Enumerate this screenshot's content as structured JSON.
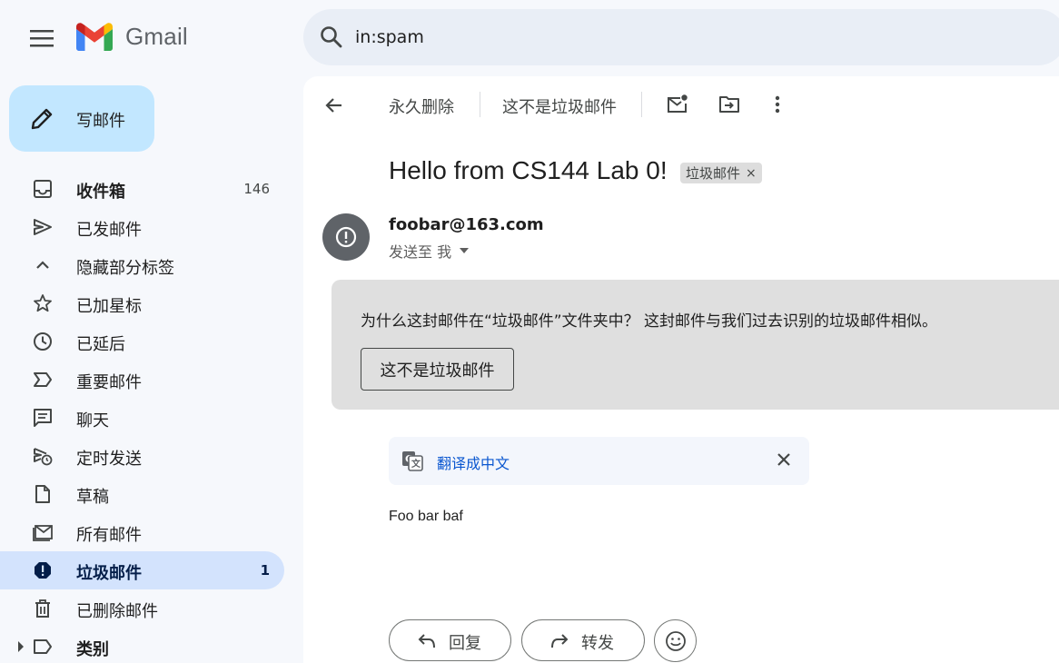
{
  "app": {
    "name": "Gmail"
  },
  "search": {
    "value": "in:spam"
  },
  "compose": {
    "label": "写邮件"
  },
  "sidebar": {
    "items": [
      {
        "label": "收件箱",
        "count": "146",
        "icon": "inbox-icon"
      },
      {
        "label": "已发邮件",
        "icon": "send-icon"
      },
      {
        "label": "隐藏部分标签",
        "icon": "chevron-up-icon"
      },
      {
        "label": "已加星标",
        "icon": "star-icon"
      },
      {
        "label": "已延后",
        "icon": "clock-icon"
      },
      {
        "label": "重要邮件",
        "icon": "important-icon"
      },
      {
        "label": "聊天",
        "icon": "chat-icon"
      },
      {
        "label": "定时发送",
        "icon": "scheduled-send-icon"
      },
      {
        "label": "草稿",
        "icon": "draft-icon"
      },
      {
        "label": "所有邮件",
        "icon": "all-mail-icon"
      },
      {
        "label": "垃圾邮件",
        "count": "1",
        "icon": "spam-icon"
      },
      {
        "label": "已删除邮件",
        "icon": "trash-icon"
      },
      {
        "label": "类别",
        "icon": "label-icon"
      }
    ]
  },
  "toolbar": {
    "delete_forever": "永久删除",
    "not_spam": "这不是垃圾邮件"
  },
  "email": {
    "subject": "Hello from CS144 Lab 0!",
    "label_chip": "垃圾邮件",
    "label_chip_close": "×",
    "sender": "foobar@163.com",
    "recipient": "发送至 我",
    "spam_notice": "为什么这封邮件在“垃圾邮件”文件夹中？ 这封邮件与我们过去识别的垃圾邮件相似。",
    "not_spam_button": "这不是垃圾邮件",
    "translate_link": "翻译成中文",
    "body": "Foo bar baf"
  },
  "actions": {
    "reply": "回复",
    "forward": "转发"
  },
  "colors": {
    "background": "#f6f8fc",
    "compose": "#c2e7ff",
    "active_nav": "#d3e3fd",
    "search": "#e9eef6",
    "spam_box": "#dfdfdf",
    "link": "#0b57d0"
  }
}
